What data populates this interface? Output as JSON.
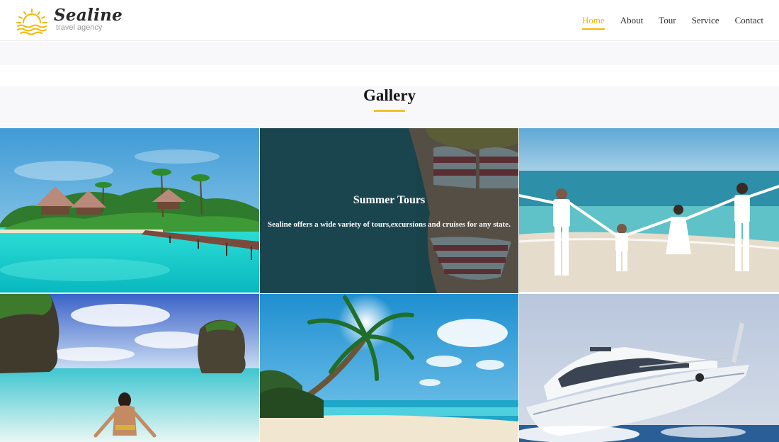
{
  "brand": {
    "name": "Sealine",
    "tagline": "travel agency",
    "logo_icon": "sun-over-waves-icon",
    "accent_color": "#f2b705"
  },
  "nav": {
    "items": [
      {
        "label": "Home",
        "active": true
      },
      {
        "label": "About",
        "active": false
      },
      {
        "label": "Tour",
        "active": false
      },
      {
        "label": "Service",
        "active": false
      },
      {
        "label": "Contact",
        "active": false
      }
    ]
  },
  "gallery": {
    "title": "Gallery",
    "underline_color": "#f2c12e",
    "featured": {
      "title": "Summer Tours",
      "description": "Sealine offers a wide variety of tours,excursions and cruises for any state."
    },
    "photos": [
      "maldives-bungalows-photo",
      "beach-bikini-photo",
      "family-on-beach-photo",
      "woman-in-lagoon-photo",
      "palm-tree-beach-photo",
      "white-yacht-photo"
    ]
  }
}
